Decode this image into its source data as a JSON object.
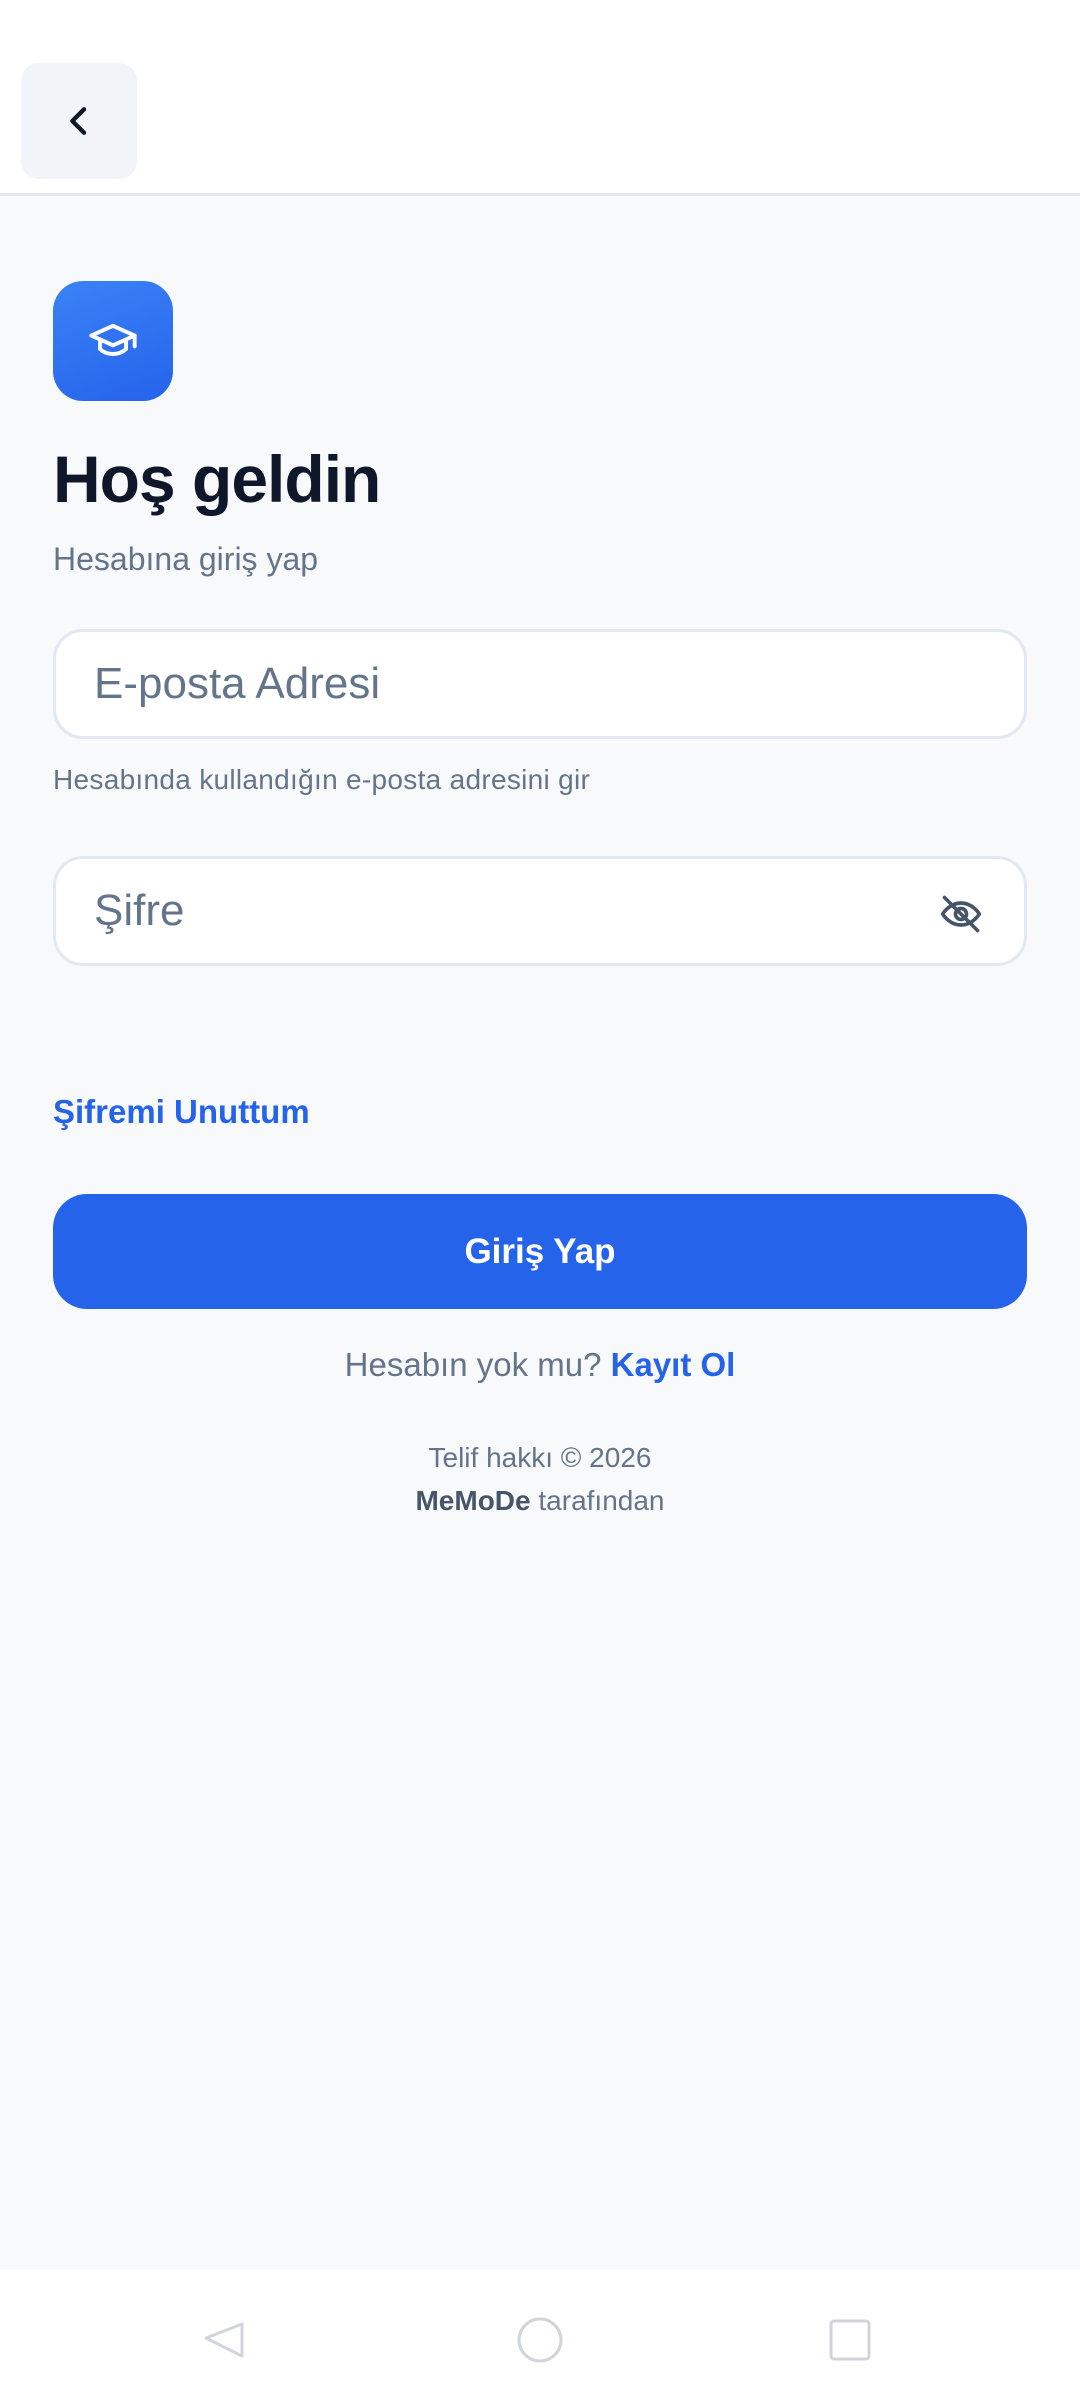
{
  "header": {
    "back_icon": "chevron-left-icon"
  },
  "brand": {
    "logo_icon": "graduation-cap-icon",
    "accent_color": "#2563eb"
  },
  "login": {
    "title": "Hoş geldin",
    "subtitle": "Hesabına giriş yap",
    "email": {
      "placeholder": "E-posta Adresi",
      "value": "",
      "helper": "Hesabında kullandığın e-posta adresini gir"
    },
    "password": {
      "placeholder": "Şifre",
      "value": "",
      "visibility_icon": "eye-off-icon"
    },
    "forgot_password": "Şifremi Unuttum",
    "submit_label": "Giriş Yap",
    "no_account_text": "Hesabın yok mu?",
    "signup_label": "Kayıt Ol"
  },
  "footer": {
    "copyright": "Telif hakkı © 2026",
    "brand_name": "MeMoDe",
    "by_text": "tarafından"
  },
  "system_nav": {
    "back": "nav-back-icon",
    "home": "nav-home-icon",
    "recents": "nav-recents-icon"
  }
}
